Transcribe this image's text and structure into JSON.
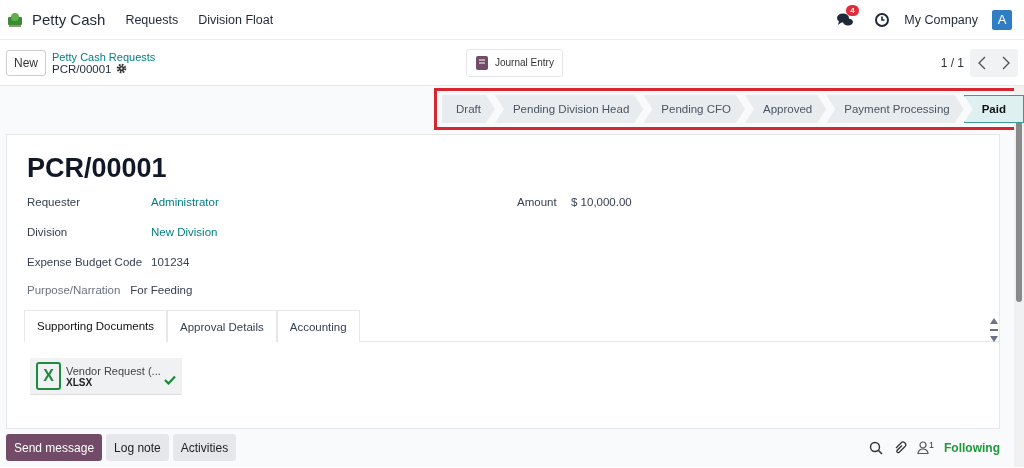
{
  "navbar": {
    "app_name": "Petty Cash",
    "menu": [
      "Requests",
      "Division Float"
    ],
    "messages_badge": "4",
    "company": "My Company",
    "avatar": "A"
  },
  "control_panel": {
    "new_button": "New",
    "breadcrumb": "Petty Cash Requests",
    "record": "PCR/00001",
    "smart_button": "Journal Entry",
    "pager": "1 / 1"
  },
  "statusbar": [
    {
      "label": "Draft",
      "selected": false
    },
    {
      "label": "Pending Division Head",
      "selected": false
    },
    {
      "label": "Pending CFO",
      "selected": false
    },
    {
      "label": "Approved",
      "selected": false
    },
    {
      "label": "Payment Processing",
      "selected": false
    },
    {
      "label": "Paid",
      "selected": true
    }
  ],
  "form": {
    "title": "PCR/00001",
    "left_fields": [
      {
        "label": "Requester",
        "value": "Administrator",
        "kind": "link"
      },
      {
        "label": "Division",
        "value": "New Division",
        "kind": "link"
      },
      {
        "label": "Expense Budget Code",
        "value": "101234",
        "kind": "text"
      }
    ],
    "right_fields": [
      {
        "label": "Amount",
        "value": "$ 10,000.00"
      }
    ],
    "narration": {
      "label": "Purpose/Narration",
      "value": "For Feeding"
    },
    "tabs": [
      {
        "label": "Supporting Documents",
        "selected": true
      },
      {
        "label": "Approval Details",
        "selected": false
      },
      {
        "label": "Accounting",
        "selected": false
      }
    ],
    "attachments": [
      {
        "name": "Vendor Request (...",
        "type": "XLSX",
        "icon": "X"
      }
    ]
  },
  "chatter": {
    "buttons": [
      {
        "label": "Send message",
        "selected": true
      },
      {
        "label": "Log note",
        "selected": false
      },
      {
        "label": "Activities",
        "selected": false
      }
    ],
    "followers_count": "1",
    "follow_status": "Following"
  }
}
